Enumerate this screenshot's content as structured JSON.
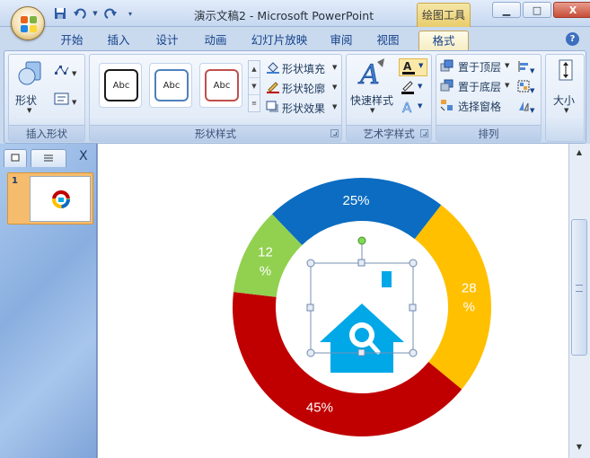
{
  "window": {
    "doc_title": "演示文稿2 - Microsoft PowerPoint",
    "context_tab_title": "绘图工具",
    "minimize_glyph": "▁",
    "maximize_glyph": "□",
    "close_glyph": "X"
  },
  "quick_access": {
    "save_icon": "save-icon",
    "undo_icon": "undo-icon",
    "redo_icon": "redo-icon",
    "customize_icon": "customize-qat-icon"
  },
  "tabs": [
    "开始",
    "插入",
    "设计",
    "动画",
    "幻灯片放映",
    "审阅",
    "视图",
    "格式"
  ],
  "active_tab": "格式",
  "ribbon": {
    "insert_shapes": {
      "label": "插入形状",
      "shapes_button": "形状"
    },
    "shape_styles": {
      "label": "形状样式",
      "styles": [
        {
          "text": "Abc",
          "border": "#1a1a1a"
        },
        {
          "text": "Abc",
          "border": "#4f81bd"
        },
        {
          "text": "Abc",
          "border": "#c0504d"
        }
      ],
      "fill": "形状填充",
      "outline": "形状轮廓",
      "effects": "形状效果"
    },
    "wordart_styles": {
      "label": "艺术字样式",
      "quick_styles": "快速样式"
    },
    "arrange": {
      "label": "排列",
      "bring_front": "置于顶层",
      "send_back": "置于底层",
      "selection_pane": "选择窗格"
    },
    "size": {
      "label": "大小"
    }
  },
  "slide_panel": {
    "slide_number": "1",
    "close_glyph": "X"
  },
  "chart_data": {
    "type": "pie",
    "title": "",
    "categories": [
      "25%",
      "28%",
      "45%",
      "12%"
    ],
    "values": [
      25,
      28,
      45,
      12
    ],
    "colors": [
      "#0b6cc2",
      "#ffc000",
      "#c00000",
      "#92d050"
    ],
    "labels": [
      "25%",
      "28%",
      "45%",
      "12%"
    ],
    "center_icon": "house-search-icon"
  },
  "colors": {
    "accent": "#00a8e8"
  }
}
